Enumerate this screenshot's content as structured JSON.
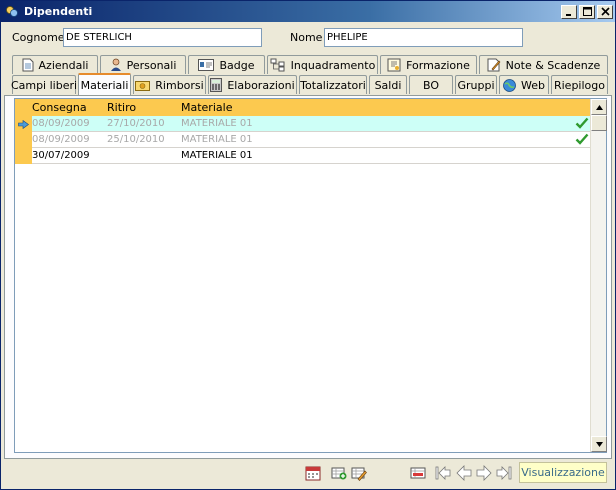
{
  "window": {
    "title": "Dipendenti"
  },
  "form": {
    "cognome_label": "Cognome",
    "cognome_value": "DE STERLICH",
    "nome_label": "Nome",
    "nome_value": "PHELIPE"
  },
  "tabs_row1": [
    {
      "label": "Aziendali",
      "icon": "document-icon"
    },
    {
      "label": "Personali",
      "icon": "person-icon"
    },
    {
      "label": "Badge",
      "icon": "badge-icon"
    },
    {
      "label": "Inquadramento",
      "icon": "hierarchy-icon"
    },
    {
      "label": "Formazione",
      "icon": "certificate-icon"
    },
    {
      "label": "Note & Scadenze",
      "icon": "note-pencil-icon"
    }
  ],
  "tabs_row2": [
    {
      "label": "Campi liberi"
    },
    {
      "label": "Materiali",
      "active": true
    },
    {
      "label": "Rimborsi",
      "icon": "money-icon"
    },
    {
      "label": "Elaborazioni",
      "icon": "calculator-icon"
    },
    {
      "label": "Totalizzatori"
    },
    {
      "label": "Saldi"
    },
    {
      "label": "BO"
    },
    {
      "label": "Gruppi"
    },
    {
      "label": "Web",
      "icon": "globe-icon"
    },
    {
      "label": "Riepilogo"
    }
  ],
  "grid": {
    "columns": [
      "Consegna",
      "Ritiro",
      "Materiale"
    ],
    "rows": [
      {
        "consegna": "08/09/2009",
        "ritiro": "27/10/2010",
        "materiale": "MATERIALE 01",
        "returned": true,
        "selected": true
      },
      {
        "consegna": "08/09/2009",
        "ritiro": "25/10/2010",
        "materiale": "MATERIALE 01",
        "returned": true,
        "selected": false
      },
      {
        "consegna": "30/07/2009",
        "ritiro": "",
        "materiale": "MATERIALE 01",
        "returned": false,
        "selected": false
      }
    ]
  },
  "toolbar": {
    "icons": [
      "calendar-icon",
      "add-record-icon",
      "edit-record-icon",
      "delete-record-icon",
      "first-record-icon",
      "previous-record-icon",
      "next-record-icon",
      "last-record-icon"
    ]
  },
  "status": {
    "mode": "Visualizzazione"
  },
  "colors": {
    "header": "#fcc94f",
    "selected_row": "#cdfff7",
    "check": "#2f9a2f",
    "status_bg": "#ffffc8"
  }
}
